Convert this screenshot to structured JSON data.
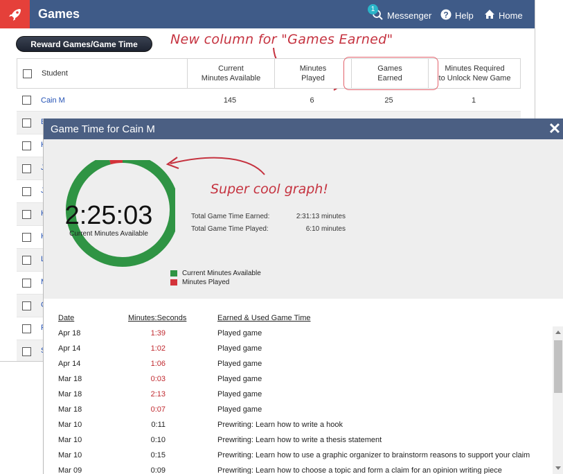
{
  "header": {
    "title": "Games",
    "messenger_label": "Messenger",
    "messenger_badge": "1",
    "help_label": "Help",
    "home_label": "Home"
  },
  "toolbar": {
    "reward_label": "Reward Games/Game Time"
  },
  "annotations": {
    "column_note": "New column for \"Games Earned\"",
    "graph_note": "Super cool graph!"
  },
  "table": {
    "columns": [
      "Student",
      "Current Minutes Available",
      "Minutes Played",
      "Games Earned",
      "Minutes Required to Unlock New Game"
    ],
    "column_lines": {
      "c1": [
        "Current",
        "Minutes Available"
      ],
      "c2": [
        "Minutes",
        "Played"
      ],
      "c3": [
        "Games",
        "Earned"
      ],
      "c4": [
        "Minutes Required",
        "to Unlock New Game"
      ]
    },
    "first_row": {
      "student": "Cain M",
      "minutes_available": "145",
      "minutes_played": "6",
      "games_earned": "25",
      "minutes_required": "1"
    },
    "partial_initials": [
      "E",
      "K",
      "J",
      "J",
      "K",
      "K",
      "L",
      "M",
      "C",
      "F",
      "S"
    ]
  },
  "modal": {
    "title": "Game Time for Cain M",
    "big_time": "2:25:03",
    "big_time_label": "Current Minutes Available",
    "earned_label": "Total Game Time Earned:",
    "earned_value": "2:31:13 minutes",
    "played_label": "Total Game Time Played:",
    "played_value": "6:10 minutes",
    "legend_available": "Current Minutes Available",
    "legend_played": "Minutes Played",
    "log_headers": {
      "date": "Date",
      "minutes": "Minutes:Seconds",
      "activity": "Earned & Used Game Time"
    },
    "log": [
      {
        "date": "Apr 18",
        "minutes": "1:39",
        "activity": "Played game",
        "used": true
      },
      {
        "date": "Apr 14",
        "minutes": "1:02",
        "activity": "Played game",
        "used": true
      },
      {
        "date": "Apr 14",
        "minutes": "1:06",
        "activity": "Played game",
        "used": true
      },
      {
        "date": "Mar 18",
        "minutes": "0:03",
        "activity": "Played game",
        "used": true
      },
      {
        "date": "Mar 18",
        "minutes": "2:13",
        "activity": "Played game",
        "used": true
      },
      {
        "date": "Mar 18",
        "minutes": "0:07",
        "activity": "Played game",
        "used": true
      },
      {
        "date": "Mar 10",
        "minutes": "0:11",
        "activity": "Prewriting: Learn how to write a hook",
        "used": false
      },
      {
        "date": "Mar 10",
        "minutes": "0:10",
        "activity": "Prewriting: Learn how to write a thesis statement",
        "used": false
      },
      {
        "date": "Mar 10",
        "minutes": "0:15",
        "activity": "Prewriting: Learn how to use a graphic organizer to brainstorm reasons to support your claim",
        "used": false
      },
      {
        "date": "Mar 09",
        "minutes": "0:09",
        "activity": "Prewriting: Learn how to choose a topic and form a claim for an opinion writing piece",
        "used": false
      }
    ]
  },
  "chart_data": {
    "type": "pie",
    "categories": [
      "Current Minutes Available",
      "Minutes Played"
    ],
    "values": [
      145.05,
      6.17
    ],
    "colors": [
      "#2f9444",
      "#d3333a"
    ]
  },
  "colors": {
    "header_bg": "#3f5b88",
    "logo_bg": "#e5403a",
    "modal_header": "#4b5f83",
    "used_time": "#c0282e",
    "link": "#2452b5"
  }
}
